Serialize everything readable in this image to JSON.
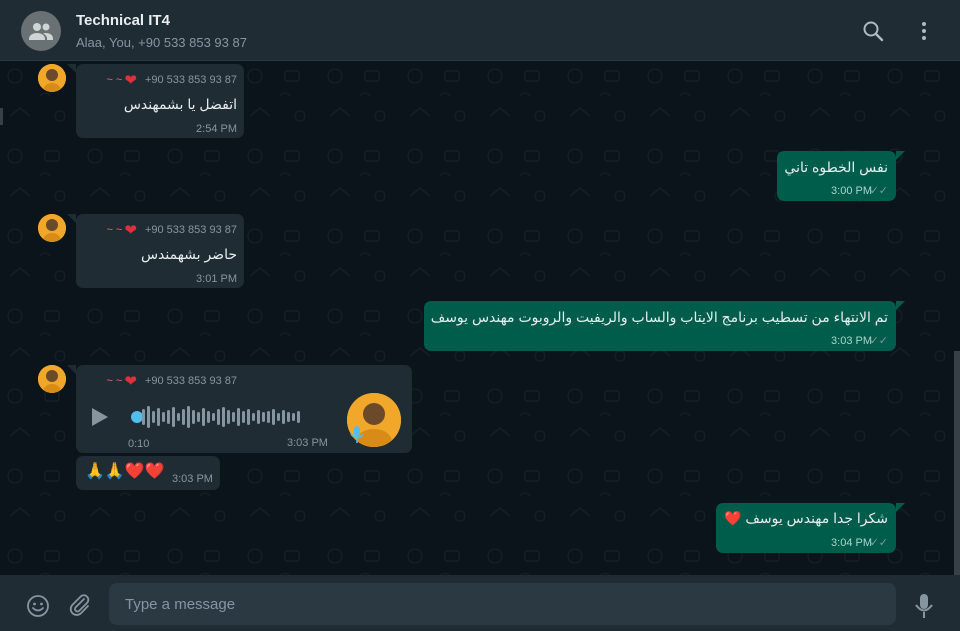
{
  "header": {
    "title": "Technical IT4",
    "subtitle": "Alaa, You, +90 533 853 93 87",
    "avatar_icon": "group-icon",
    "search_icon": "search-icon",
    "menu_icon": "more-vert-icon"
  },
  "messages": [
    {
      "direction": "in",
      "sender_phone": "+90 533 853 93 87",
      "sender_name": "~ ~",
      "text": "اتفضل يا بشمهندس",
      "time": "2:54 PM"
    },
    {
      "direction": "out",
      "text": "نفس الخطوه تاني",
      "time": "3:00 PM"
    },
    {
      "direction": "in",
      "sender_phone": "+90 533 853 93 87",
      "sender_name": "~ ~",
      "text": "حاضر بشهمندس",
      "time": "3:01 PM"
    },
    {
      "direction": "out",
      "text": "تم الانتهاء من تسطيب برنامج الايتاب والساب والريفيت والروبوت مهندس يوسف",
      "time": "3:03 PM"
    },
    {
      "direction": "in",
      "type": "voice",
      "sender_phone": "+90 533 853 93 87",
      "sender_name": "~ ~",
      "duration": "0:10",
      "time": "3:03 PM"
    },
    {
      "direction": "in",
      "text": "🙏🙏❤️❤️",
      "time": "3:03 PM"
    },
    {
      "direction": "out",
      "text": "شكرا جدا مهندس يوسف ❤️",
      "time": "3:04 PM"
    }
  ],
  "footer": {
    "placeholder": "Type a message",
    "emoji_icon": "emoji-icon",
    "attach_icon": "paperclip-icon",
    "mic_icon": "microphone-icon"
  },
  "colors": {
    "header_bg": "#202c33",
    "chat_bg": "#0b141a",
    "bubble_in": "#202c33",
    "bubble_out": "#005c4b",
    "text_primary": "#e9edef",
    "text_secondary": "#8696a0",
    "heart": "#e0303e"
  }
}
